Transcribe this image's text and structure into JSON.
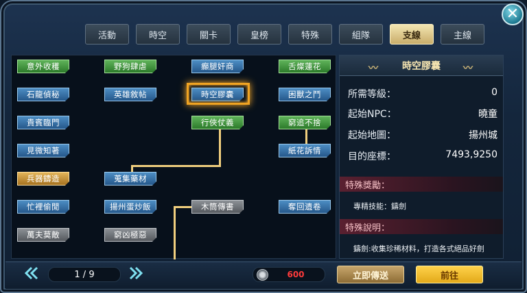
{
  "window": {
    "close_icon": "close-icon",
    "accent_color": "#f0a423"
  },
  "tabs": [
    {
      "label": "活動",
      "active": false
    },
    {
      "label": "時空",
      "active": false
    },
    {
      "label": "關卡",
      "active": false
    },
    {
      "label": "皇榜",
      "active": false
    },
    {
      "label": "特殊",
      "active": false
    },
    {
      "label": "組隊",
      "active": false
    },
    {
      "label": "支線",
      "active": true
    },
    {
      "label": "主線",
      "active": false
    }
  ],
  "quests": [
    {
      "label": "意外收穫",
      "status": "green"
    },
    {
      "label": "野狗肆虐",
      "status": "green"
    },
    {
      "label": "癲腿奸商",
      "status": "blue"
    },
    {
      "label": "舌燦蓮花",
      "status": "green"
    },
    {
      "label": "石龍偵秘",
      "status": "blue"
    },
    {
      "label": "英雄敘帖",
      "status": "blue"
    },
    {
      "label": "時空膠囊",
      "status": "blue",
      "selected": true
    },
    {
      "label": "困獸之鬥",
      "status": "blue"
    },
    {
      "label": "貴賓臨門",
      "status": "blue"
    },
    {
      "label": "行俠仗義",
      "status": "green"
    },
    {
      "label": "窮追不捨",
      "status": "green"
    },
    {
      "label": "見微知著",
      "status": "blue"
    },
    {
      "label": "紙花訴情",
      "status": "blue"
    },
    {
      "label": "兵器鑄造",
      "status": "gold"
    },
    {
      "label": "蒐集藥材",
      "status": "blue"
    },
    {
      "label": "忙裡偷閒",
      "status": "blue"
    },
    {
      "label": "揚州蛋炒飯",
      "status": "blue"
    },
    {
      "label": "木筒傳書",
      "status": "gray"
    },
    {
      "label": "奪回遺卷",
      "status": "blue"
    },
    {
      "label": "萬夫莫敵",
      "status": "gray"
    },
    {
      "label": "窮凶極惡",
      "status": "gray"
    }
  ],
  "detail": {
    "title": "時空膠囊",
    "rows": [
      {
        "key": "所需等級：",
        "value": "0"
      },
      {
        "key": "起始NPC：",
        "value": "曉童"
      },
      {
        "key": "起始地圖：",
        "value": "揚州城"
      },
      {
        "key": "目的座標：",
        "value": "7493,9250"
      }
    ],
    "reward_title": "特殊獎勵：",
    "reward_text": "專精技能：鑄劍",
    "desc_title": "特殊說明：",
    "desc_text": "鑄劍:收集珍稀材料，打造各式絕品好劍"
  },
  "footer": {
    "page": "1 / 9",
    "prev_icon": "double-chevron-left-icon",
    "next_icon": "double-chevron-right-icon",
    "coin_icon": "coin-icon",
    "cost": "600",
    "teleport_label": "立即傳送",
    "go_label": "前往"
  }
}
